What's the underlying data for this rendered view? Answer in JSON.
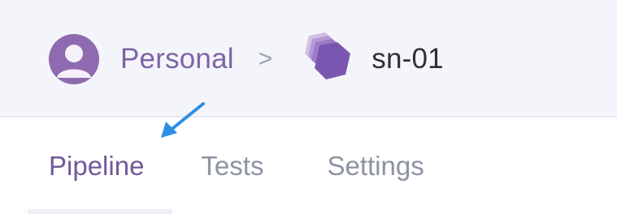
{
  "breadcrumb": {
    "account_label": "Personal",
    "separator": ">",
    "project_label": "sn-01"
  },
  "tabs": [
    {
      "label": "Pipeline",
      "active": true
    },
    {
      "label": "Tests",
      "active": false
    },
    {
      "label": "Settings",
      "active": false
    }
  ],
  "icons": {
    "avatar": "user-avatar-icon",
    "project": "stacked-hexagon-project-icon",
    "annotation": "blue-arrow-pointer-icon"
  },
  "colors": {
    "header_bg": "#f4f5fa",
    "accent_purple": "#7d64a6",
    "active_tab": "#6f5a99",
    "inactive_tab": "#8d93a2",
    "arrow_blue": "#2f8ee6"
  }
}
